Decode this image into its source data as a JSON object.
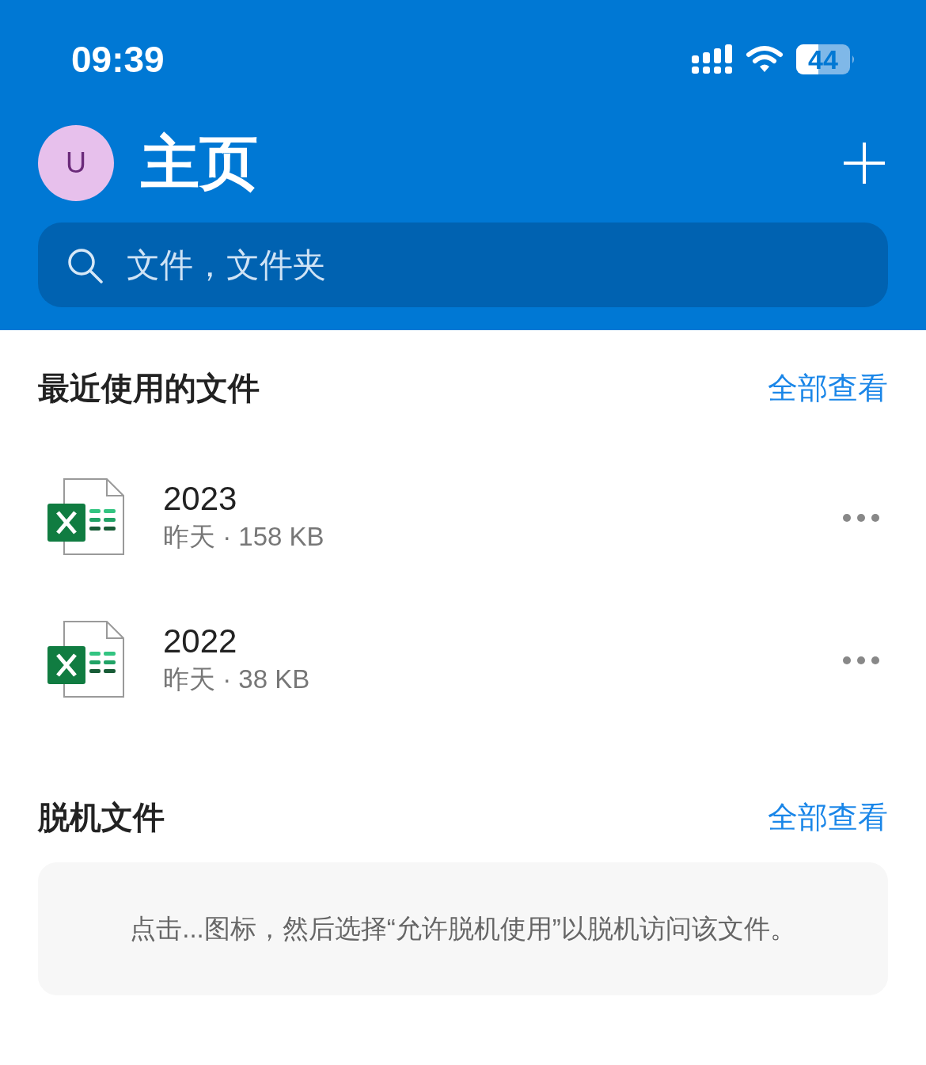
{
  "status_bar": {
    "time": "09:39",
    "battery": "44"
  },
  "header": {
    "avatar": "U",
    "title": "主页",
    "search": {
      "placeholder": "文件，文件夹"
    }
  },
  "sections": [
    {
      "title": "最近使用的文件",
      "link": "全部查看",
      "files": [
        {
          "name": "2023",
          "details": "昨天 · 158 KB"
        },
        {
          "name": "2022",
          "details": "昨天 · 38 KB"
        }
      ]
    },
    {
      "title": "脱机文件",
      "link": "全部查看",
      "message": "点击...图标，然后选择“允许脱机使用”以脱机访问该文件。"
    }
  ]
}
